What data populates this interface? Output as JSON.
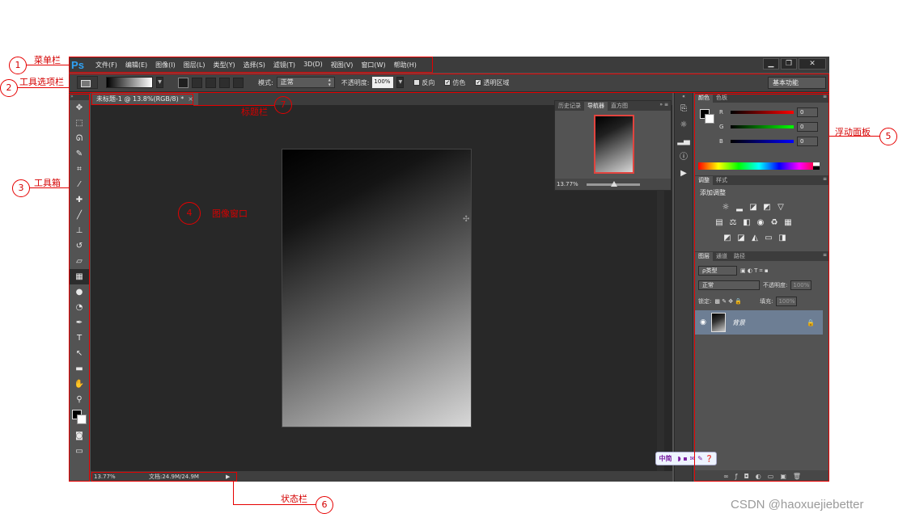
{
  "app": {
    "logo": "Ps",
    "menu": [
      "文件(F)",
      "编辑(E)",
      "图像(I)",
      "图层(L)",
      "类型(Y)",
      "选择(S)",
      "滤镜(T)",
      "3D(D)",
      "视图(V)",
      "窗口(W)",
      "帮助(H)"
    ],
    "window_buttons": [
      "▁",
      "❐",
      "✕"
    ]
  },
  "options_bar": {
    "mode_label": "模式:",
    "mode_value": "正常",
    "opacity_label": "不透明度:",
    "opacity_value": "100%",
    "reverse_label": "反向",
    "dither_label": "仿色",
    "transparency_label": "透明区域",
    "workspace": "基本功能"
  },
  "document": {
    "tab_title": "未标题-1 @ 13.8%(RGB/8) *",
    "tab_close": "×"
  },
  "statusbar": {
    "zoom": "13.77%",
    "doc_info": "文档:24.9M/24.9M",
    "arrow": "▶"
  },
  "navigator_panel": {
    "tabs": [
      "历史记录",
      "导航器",
      "直方图"
    ],
    "zoom": "13.77%"
  },
  "color_panel": {
    "tabs": [
      "颜色",
      "色板"
    ],
    "channels": [
      {
        "label": "R",
        "value": "0",
        "color": "#d93030"
      },
      {
        "label": "G",
        "value": "0",
        "color": "#2fb53a"
      },
      {
        "label": "B",
        "value": "0",
        "color": "#2f3ad9"
      }
    ]
  },
  "adjustments_panel": {
    "tabs": [
      "调整",
      "样式"
    ],
    "title": "添加调整"
  },
  "layers_panel": {
    "tabs": [
      "图层",
      "通道",
      "路径"
    ],
    "filter": "ρ类型",
    "blend_mode": "正常",
    "opacity_label": "不透明度:",
    "opacity_value": "100%",
    "lock_label": "锁定:",
    "fill_label": "填充:",
    "fill_value": "100%",
    "layer_name": "背景"
  },
  "ime": {
    "label": "中简"
  },
  "annotations": [
    {
      "num": "1",
      "label": "菜单栏"
    },
    {
      "num": "2",
      "label": "工具选项栏"
    },
    {
      "num": "3",
      "label": "工具箱"
    },
    {
      "num": "4",
      "label": "图像窗口"
    },
    {
      "num": "5",
      "label": "浮动面板"
    },
    {
      "num": "6",
      "label": "状态栏"
    },
    {
      "num": "7",
      "label": "标题栏"
    }
  ],
  "watermark": "CSDN @haoxuejiebetter",
  "colors": {
    "annotation": "#e60000",
    "ps_logo": "#2fa3f5",
    "selected_layer": "#6d7e94"
  }
}
